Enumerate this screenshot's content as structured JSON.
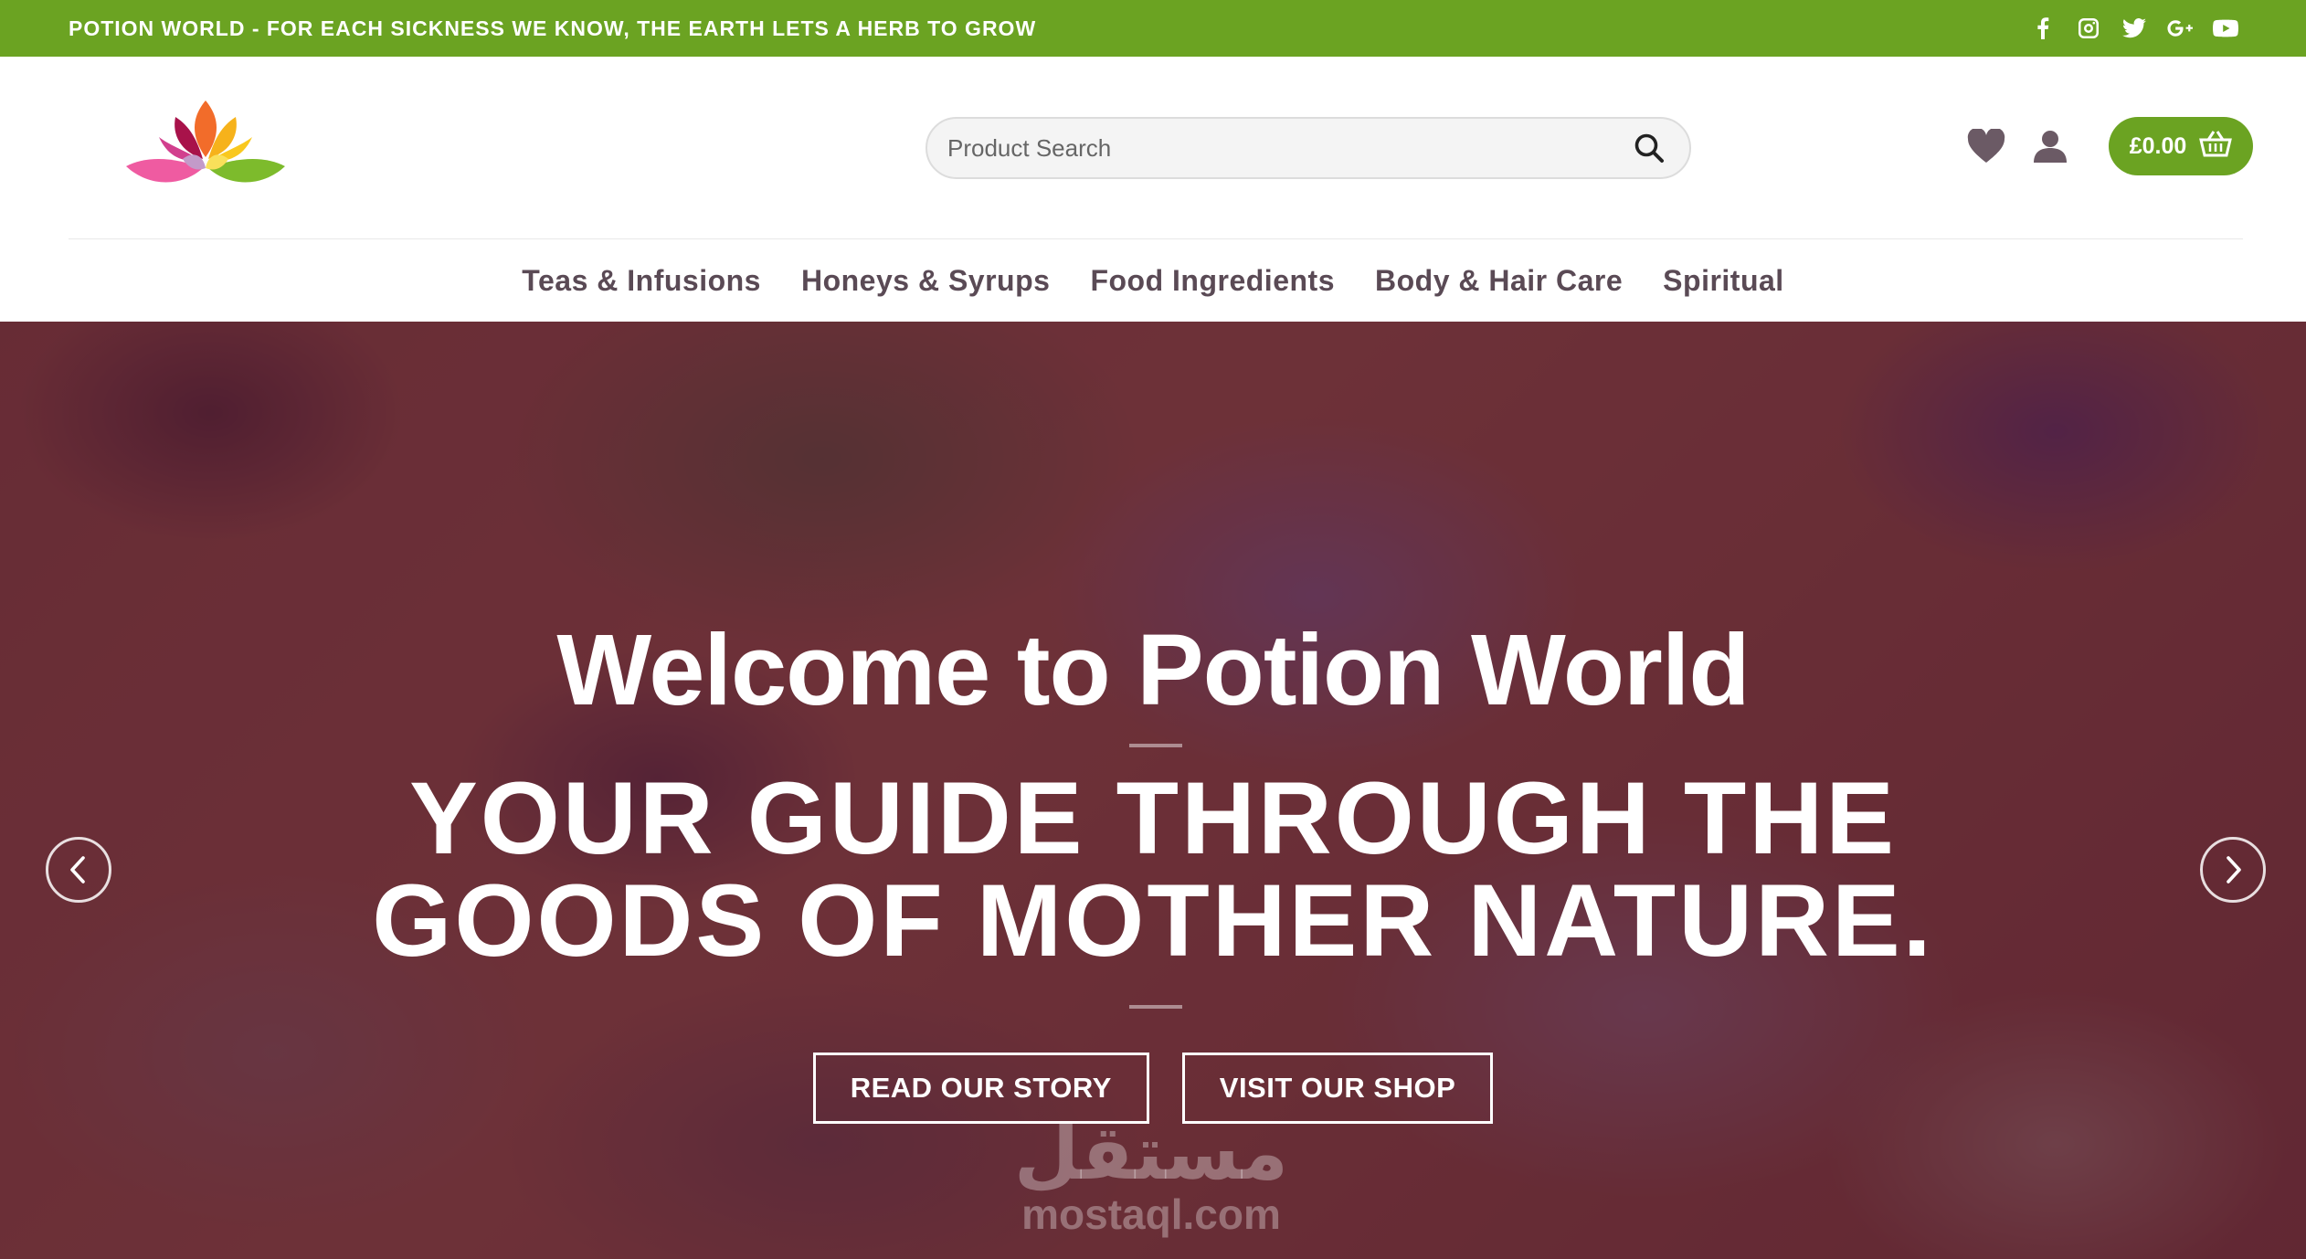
{
  "topbar": {
    "announcement": "POTION WORLD - FOR EACH SICKNESS WE KNOW, THE EARTH LETS A HERB TO GROW",
    "social_icons": [
      "facebook-icon",
      "instagram-icon",
      "twitter-icon",
      "google-plus-icon",
      "youtube-icon"
    ]
  },
  "header": {
    "search": {
      "placeholder": "Product Search",
      "value": ""
    },
    "cart": {
      "total": "£0.00"
    }
  },
  "nav": {
    "items": [
      {
        "label": "Teas & Infusions"
      },
      {
        "label": "Honeys & Syrups"
      },
      {
        "label": "Food Ingredients"
      },
      {
        "label": "Body & Hair Care"
      },
      {
        "label": "Spiritual"
      }
    ]
  },
  "hero": {
    "title": "Welcome to Potion World",
    "subtitle_line1": "YOUR GUIDE THROUGH THE",
    "subtitle_line2": "GOODS OF MOTHER NATURE.",
    "buttons": {
      "story": "READ OUR STORY",
      "shop": "VISIT OUR SHOP"
    }
  },
  "watermark": {
    "arabic": "مستقل",
    "latin": "mostaql.com"
  },
  "colors": {
    "brand_green": "#6ba322",
    "overlay": "#5c193a",
    "nav_text": "#5a4a55"
  }
}
